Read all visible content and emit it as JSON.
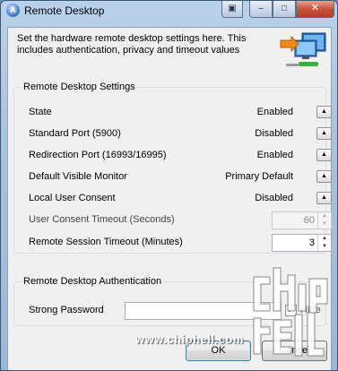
{
  "window": {
    "title": "Remote Desktop"
  },
  "titlebar": {
    "help": "▣",
    "minimize": "–",
    "maximize": "□",
    "close": "✕"
  },
  "intro": "Set the hardware remote desktop settings here. This includes authentication, privacy and timeout values",
  "settings_group": {
    "title": "Remote Desktop Settings",
    "rows": [
      {
        "label": "State",
        "value": "Enabled"
      },
      {
        "label": "Standard Port (5900)",
        "value": "Disabled"
      },
      {
        "label": "Redirection Port (16993/16995)",
        "value": "Enabled"
      },
      {
        "label": "Default Visible Monitor",
        "value": "Primary Default"
      },
      {
        "label": "Local User Consent",
        "value": "Disabled"
      }
    ],
    "consent_timeout": {
      "label": "User Consent Timeout (Seconds)",
      "value": "60"
    },
    "session_timeout": {
      "label": "Remote Session Timeout (Minutes)",
      "value": "3"
    }
  },
  "auth_group": {
    "title": "Remote Desktop Authentication",
    "password_label": "Strong Password",
    "password_value": "",
    "hide_label": "Hide",
    "hide_checked": true
  },
  "buttons": {
    "ok": "OK",
    "cancel": "Cancel"
  },
  "watermark": {
    "text": "www.chiphell.com",
    "logo_icon": "chiphell-logo"
  },
  "row_button_glyph": "▲",
  "icons": {
    "app": "remote-desktop-app-icon",
    "illustration": "remote-computers-illustration-icon"
  },
  "colors": {
    "title_bar": "#a8c3df",
    "close_button": "#c7533d",
    "dialog_bg": "#f0f0f0"
  }
}
